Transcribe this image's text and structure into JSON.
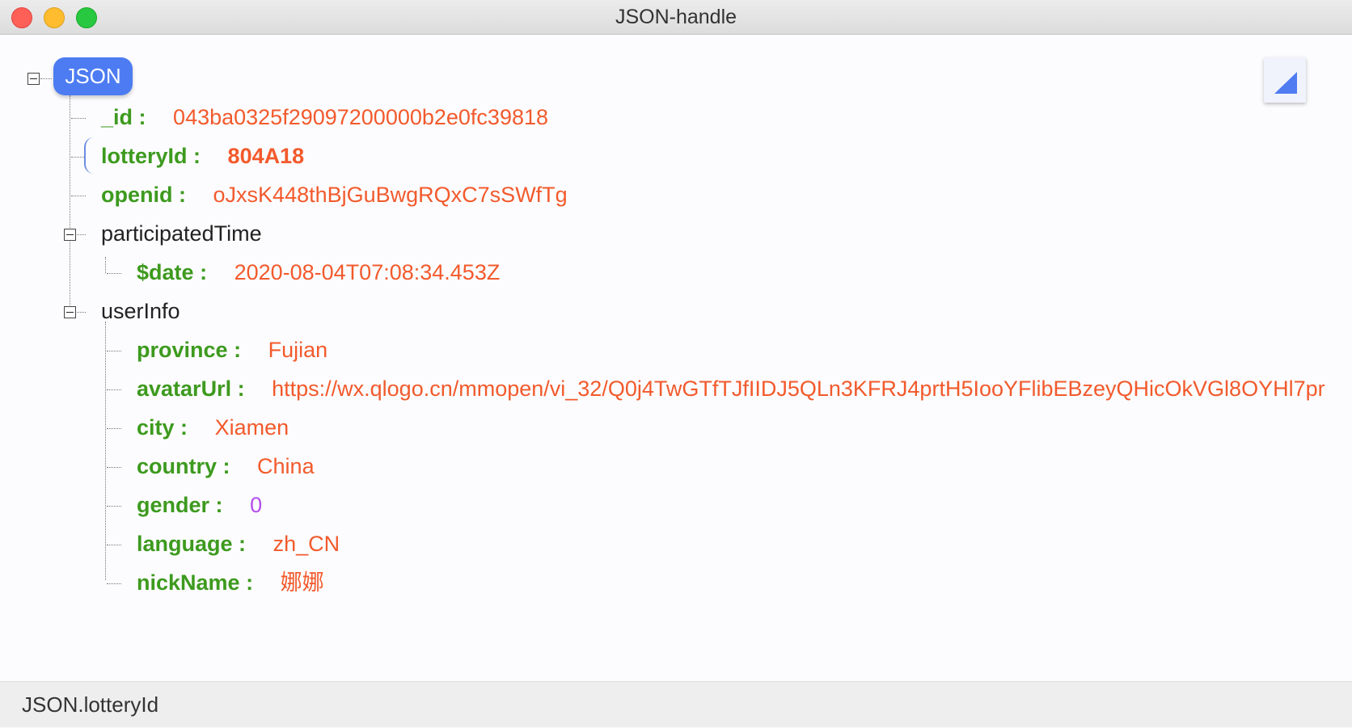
{
  "window": {
    "title": "JSON-handle"
  },
  "tree": {
    "root_label": "JSON",
    "items": [
      {
        "key": "_id",
        "value": "043ba0325f29097200000b2e0fc39818"
      },
      {
        "key": "lotteryId",
        "value": "804A18"
      },
      {
        "key": "openid",
        "value": "oJxsK448thBjGuBwgRQxC7sSWfTg"
      },
      {
        "key": "participatedTime"
      },
      {
        "key": "$date",
        "value": "2020-08-04T07:08:34.453Z"
      },
      {
        "key": "userInfo"
      },
      {
        "key": "province",
        "value": "Fujian"
      },
      {
        "key": "avatarUrl",
        "value": "https://wx.qlogo.cn/mmopen/vi_32/Q0j4TwGTfTJfIIDJ5QLn3KFRJ4prtH5IooYFlibEBzeyQHicOkVGl8OYHl7pr"
      },
      {
        "key": "city",
        "value": "Xiamen"
      },
      {
        "key": "country",
        "value": "China"
      },
      {
        "key": "gender",
        "value": "0"
      },
      {
        "key": "language",
        "value": "zh_CN"
      },
      {
        "key": "nickName",
        "value": "娜娜"
      }
    ]
  },
  "colon": ":",
  "status": {
    "path": "JSON.lotteryId"
  },
  "icons": {
    "corner": "corner-triangle-icon",
    "toggle": "collapse-minus-icon"
  },
  "colors": {
    "key": "#3d9a1e",
    "string": "#f25a2c",
    "number": "#b54ced",
    "root_badge": "#4d7cf2"
  }
}
